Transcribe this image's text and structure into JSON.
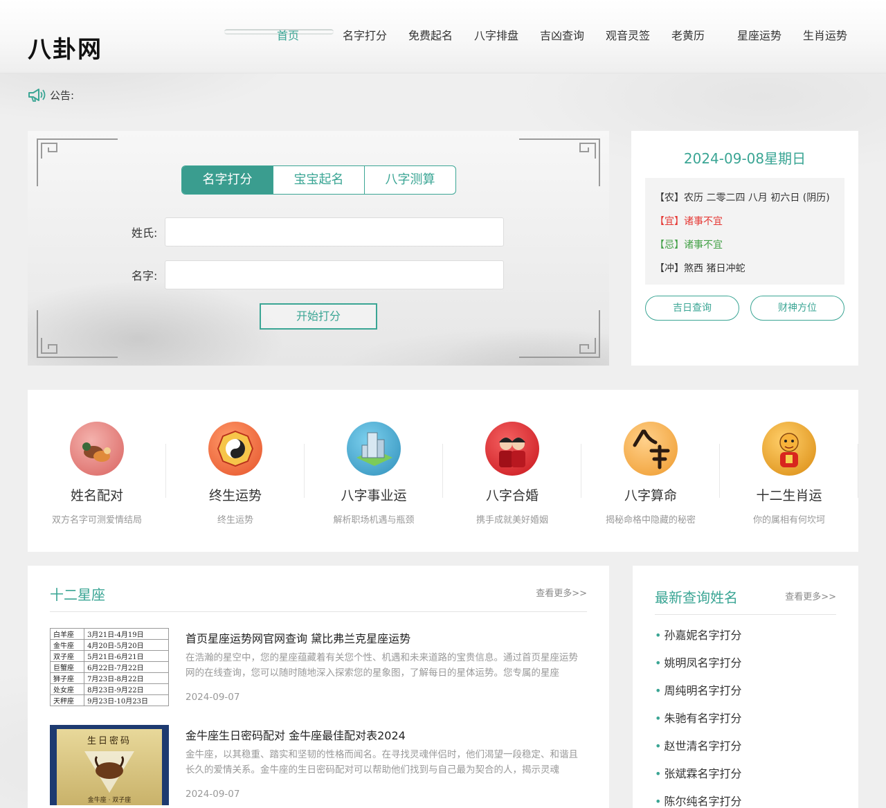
{
  "header": {
    "logo": "八卦网",
    "nav": [
      "首页",
      "名字打分",
      "免费起名",
      "八字排盘",
      "吉凶查询",
      "观音灵签",
      "老黄历",
      "星座运势",
      "生肖运势"
    ]
  },
  "notice": {
    "label": "公告:"
  },
  "search": {
    "tabs": [
      "名字打分",
      "宝宝起名",
      "八字测算"
    ],
    "surname_label": "姓氏:",
    "surname_value": "",
    "name_label": "名字:",
    "name_value": "",
    "submit": "开始打分"
  },
  "almanac": {
    "date": "2024-09-08星期日",
    "nong_tag": "【农】",
    "nong": "农历 二零二四 八月 初六日 (阴历)",
    "yi_tag": "【宜】",
    "yi": "诸事不宜",
    "ji_tag": "【忌】",
    "ji": "诸事不宜",
    "chong_tag": "【冲】",
    "chong": "煞西  猪日冲蛇",
    "buttons": [
      "吉日查询",
      "财神方位"
    ]
  },
  "features": [
    {
      "name": "姓名配对",
      "desc": "双方名字可测爱情结局",
      "icon": "mandarin-duck-icon",
      "color": "#e27a78"
    },
    {
      "name": "终生运势",
      "desc": "终生运势",
      "icon": "yin-yang-icon",
      "color": "#f2683f"
    },
    {
      "name": "八字事业运",
      "desc": "解析职场机遇与瓶颈",
      "icon": "building-icon",
      "color": "#3d9fc7"
    },
    {
      "name": "八字合婚",
      "desc": "携手成就美好婚姻",
      "icon": "wedding-couple-icon",
      "color": "#d9282e"
    },
    {
      "name": "八字算命",
      "desc": "揭秘命格中隐藏的秘密",
      "icon": "bazi-character-icon",
      "color": "#f1a33c"
    },
    {
      "name": "十二生肖运",
      "desc": "你的属相有何坎坷",
      "icon": "tiger-icon",
      "color": "#eea21c"
    }
  ],
  "zodiac": {
    "title": "十二星座",
    "more": "查看更多>>",
    "table": [
      [
        "白羊座",
        "3月21日-4月19日"
      ],
      [
        "金牛座",
        "4月20日-5月20日"
      ],
      [
        "双子座",
        "5月21日-6月21日"
      ],
      [
        "巨蟹座",
        "6月22日-7月22日"
      ],
      [
        "狮子座",
        "7月23日-8月22日"
      ],
      [
        "处女座",
        "8月23日-9月22日"
      ],
      [
        "天秤座",
        "9月23日-10月23日"
      ]
    ],
    "book_title": "生日密码",
    "book_sub": "金牛座 · 双子座",
    "articles": [
      {
        "title": "首页星座运势网官网查询 黛比弗兰克星座运势",
        "summary": "在浩瀚的星空中，您的星座蕴藏着有关您个性、机遇和未来道路的宝贵信息。通过首页星座运势网的在线查询，您可以随时随地深入探索您的星象图，了解每日的星体运势。您专属的星座",
        "date": "2024-09-07"
      },
      {
        "title": "金牛座生日密码配对 金牛座最佳配对表2024",
        "summary": "金牛座，以其稳重、踏实和坚韧的性格而闻名。在寻找灵魂伴侣时，他们渴望一段稳定、和谐且长久的爱情关系。金牛座的生日密码配对可以帮助他们找到与自己最为契合的人，揭示灵魂",
        "date": "2024-09-07"
      }
    ]
  },
  "latest": {
    "title": "最新查询姓名",
    "more": "查看更多>>",
    "items": [
      "孙嘉妮名字打分",
      "姚明凤名字打分",
      "周纯明名字打分",
      "朱驰有名字打分",
      "赵世清名字打分",
      "张斌霖名字打分",
      "陈尔纯名字打分"
    ]
  },
  "colors": {
    "accent": "#3aa594",
    "yi": "#e53935",
    "ji": "#43a047"
  }
}
